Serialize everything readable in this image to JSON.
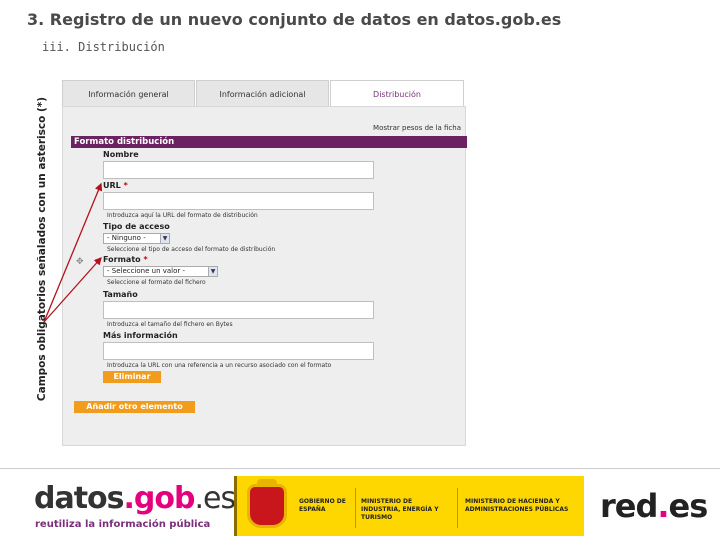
{
  "slide": {
    "title": "3. Registro de un nuevo conjunto de datos en datos.gob.es",
    "subtitle": "iii. Distribución",
    "side_note": "Campos obligatorios señalados con un asterisco (*)"
  },
  "tabs": [
    {
      "label": "Información general",
      "active": false
    },
    {
      "label": "Información adicional",
      "active": false
    },
    {
      "label": "Distribución",
      "active": true
    }
  ],
  "form": {
    "show_link": "Mostrar pesos de la ficha",
    "section_title": "Formato distribución",
    "required_mark": "*",
    "fields": {
      "name": {
        "label": "Nombre",
        "value": ""
      },
      "url": {
        "label": "URL",
        "value": "",
        "help": "Introduzca aquí la URL del formato de distribución"
      },
      "access": {
        "label": "Tipo de acceso",
        "selected": "- Ninguno -",
        "help": "Seleccione el tipo de acceso del formato de distribución"
      },
      "format": {
        "label": "Formato",
        "selected": "- Seleccione un valor -",
        "help": "Seleccione el formato del fichero"
      },
      "size": {
        "label": "Tamaño",
        "value": "",
        "help": "Introduzca el tamaño del fichero en Bytes"
      },
      "more_info": {
        "label": "Más información",
        "value": "",
        "help": "Introduzca la URL con una referencia a un recurso asociado con el formato"
      }
    },
    "remove_button": "Eliminar",
    "add_button": "Añadir otro elemento"
  },
  "footer": {
    "datos_logo": {
      "part1": "datos",
      "part2": ".gob",
      "part3": ".es",
      "tagline": "reutiliza la información pública"
    },
    "gov_block": {
      "gobierno": "GOBIERNO DE ESPAÑA",
      "ministerio1": "MINISTERIO DE INDUSTRIA, ENERGÍA Y TURISMO",
      "ministerio2": "MINISTERIO DE HACIENDA Y ADMINISTRACIONES PÚBLICAS"
    },
    "redes_logo": {
      "part1": "red",
      "dot": ".",
      "part2": "es"
    }
  },
  "colors": {
    "section_header": "#6a2262",
    "button": "#f29c1d",
    "brand_pink": "#e5007e",
    "gov_yellow": "#ffd700",
    "arrow_red": "#b3121d"
  }
}
